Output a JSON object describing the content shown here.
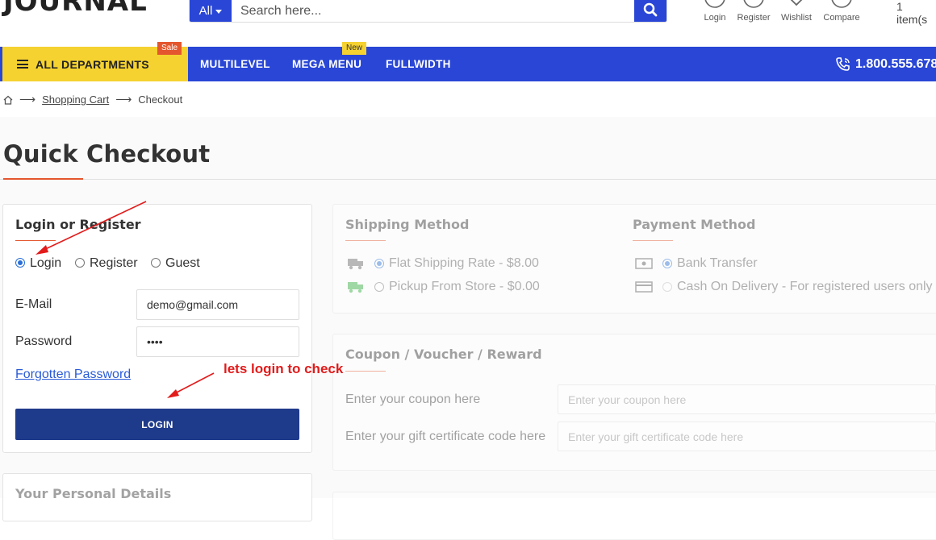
{
  "header": {
    "logo": "JOURNAL",
    "search_category": "All",
    "search_placeholder": "Search here...",
    "icons": [
      {
        "label": "Login",
        "icon": "user-icon"
      },
      {
        "label": "Register",
        "icon": "user-plus-icon"
      },
      {
        "label": "Wishlist",
        "icon": "heart-icon"
      },
      {
        "label": "Compare",
        "icon": "compare-icon"
      }
    ],
    "cart_count": "1 item(s"
  },
  "nav": {
    "departments": "ALL DEPARTMENTS",
    "sale_badge": "Sale",
    "new_badge": "New",
    "items": [
      "MULTILEVEL",
      "MEGA MENU",
      "FULLWIDTH"
    ],
    "phone": "1.800.555.678"
  },
  "breadcrumb": {
    "items": [
      "Shopping Cart",
      "Checkout"
    ],
    "separator": "⟶"
  },
  "page_title": "Quick Checkout",
  "login_panel": {
    "title": "Login or Register",
    "options": [
      {
        "label": "Login",
        "selected": true
      },
      {
        "label": "Register",
        "selected": false
      },
      {
        "label": "Guest",
        "selected": false
      }
    ],
    "email_label": "E-Mail",
    "email_value": "demo@gmail.com",
    "password_label": "Password",
    "password_value": "••••",
    "forgot_link": "Forgotten Password",
    "login_button": "LOGIN"
  },
  "personal_details": {
    "title": "Your Personal Details"
  },
  "shipping": {
    "title": "Shipping Method",
    "options": [
      {
        "label": "Flat Shipping Rate - $8.00",
        "selected": true,
        "icon": "truck-icon"
      },
      {
        "label": "Pickup From Store - $0.00",
        "selected": false,
        "icon": "truck-green-icon"
      }
    ]
  },
  "payment": {
    "title": "Payment Method",
    "options": [
      {
        "label": "Bank Transfer",
        "selected": true,
        "icon": "bank-icon"
      },
      {
        "label": "Cash On Delivery - For registered users only",
        "selected": false,
        "icon": "card-icon"
      }
    ]
  },
  "coupon": {
    "title": "Coupon / Voucher / Reward",
    "coupon_label": "Enter your coupon here",
    "coupon_placeholder": "Enter your coupon here",
    "gift_label": "Enter your gift certificate code here",
    "gift_placeholder": "Enter your gift certificate code here"
  },
  "annotation": {
    "text": "lets login to check",
    "color": "#e21b1b"
  },
  "colors": {
    "primary": "#2946d6",
    "accent_yellow": "#f5d230",
    "accent_orange": "#e4572e",
    "button_dark": "#1e3a8a"
  }
}
